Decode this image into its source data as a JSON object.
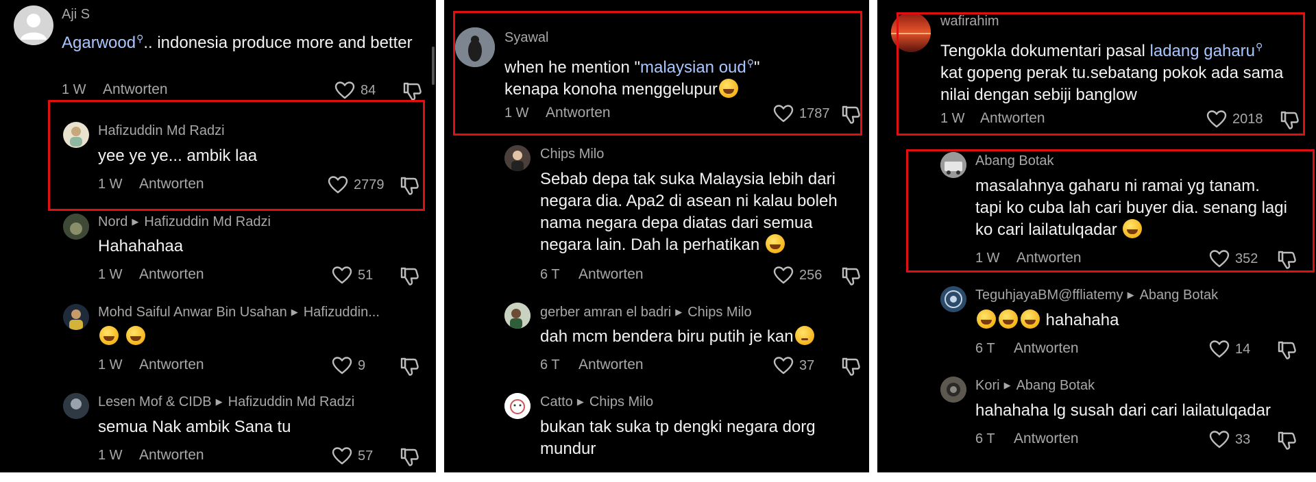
{
  "reply_label": "Antworten",
  "colors": {
    "background": "#000000",
    "highlight": "#a9c7ff",
    "muted": "#a8a8a8",
    "box": "#e01010"
  },
  "panel1": {
    "c1": {
      "user": "Aji S",
      "link": "Agarwood",
      "rest": ".. indonesia produce more and better",
      "time": "1 W",
      "likes": "84"
    },
    "c2": {
      "user": "Hafizuddin Md Radzi",
      "text": "yee ye ye... ambik laa",
      "time": "1 W",
      "likes": "2779"
    },
    "c3": {
      "user": "Nord",
      "reply_to": "Hafizuddin Md Radzi",
      "text": "Hahahahaa",
      "time": "1 W",
      "likes": "51"
    },
    "c4": {
      "user": "Mohd Saiful Anwar Bin Usahan",
      "reply_to": "Hafizuddin...",
      "time": "1 W",
      "likes": "9"
    },
    "c5": {
      "user": "Lesen Mof & CIDB",
      "reply_to": "Hafizuddin Md Radzi",
      "text": "semua Nak ambik Sana tu",
      "time": "1 W",
      "likes": "57"
    }
  },
  "panel2": {
    "c1": {
      "user": "Syawal",
      "pre": "when he mention \"",
      "link": "malaysian oud",
      "post": "\"",
      "line2": "kenapa konoha menggelupur",
      "time": "1 W",
      "likes": "1787"
    },
    "c2": {
      "user": "Chips Milo",
      "text": "Sebab depa tak suka Malaysia lebih dari negara dia. Apa2 di asean ni kalau boleh nama negara depa diatas dari semua negara lain. Dah la perhatikan",
      "time": "6 T",
      "likes": "256"
    },
    "c3": {
      "user": "gerber amran el badri",
      "reply_to": "Chips Milo",
      "text": "dah mcm bendera biru putih je kan",
      "time": "6 T",
      "likes": "37"
    },
    "c4": {
      "user": "Catto",
      "reply_to": "Chips Milo",
      "text": "bukan tak suka tp dengki negara dorg mundur"
    }
  },
  "panel3": {
    "c1": {
      "user": "wafirahim",
      "pre": "Tengokla dokumentari pasal ",
      "link": "ladang gaharu",
      "rest": "kat gopeng perak tu.sebatang pokok ada sama nilai dengan sebiji banglow",
      "time": "1 W",
      "likes": "2018"
    },
    "c2": {
      "user": "Abang Botak",
      "text": "masalahnya gaharu ni ramai yg tanam. tapi ko cuba lah cari buyer dia. senang lagi ko cari lailatulqadar",
      "time": "1 W",
      "likes": "352"
    },
    "c3": {
      "user": "TeguhjayaBM@ffliatemy",
      "reply_to": "Abang Botak",
      "text": "hahahaha",
      "time": "6 T",
      "likes": "14"
    },
    "c4": {
      "user": "Kori",
      "reply_to": "Abang Botak",
      "text": "hahahaha lg susah dari cari lailatulqadar",
      "time": "6 T",
      "likes": "33"
    }
  }
}
